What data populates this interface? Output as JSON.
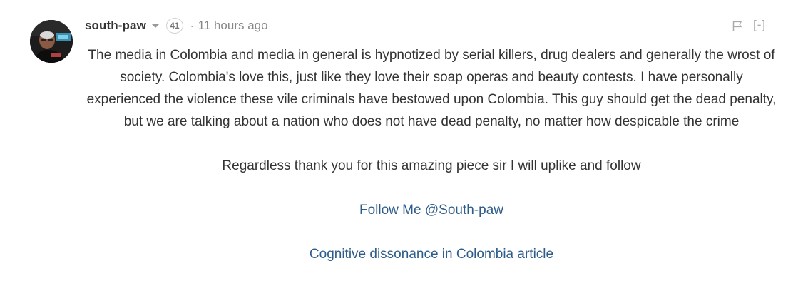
{
  "comment": {
    "author": "south-paw",
    "reputation": "41",
    "separator": "·",
    "timestamp": "11 hours ago",
    "collapse_label": "[-]",
    "icons": {
      "avatar": "user-avatar",
      "author_menu": "caret-down-icon",
      "flag": "flag-icon"
    },
    "body": {
      "paragraph_1": "The media in Colombia and media in general is hypnotized by serial killers, drug dealers and generally the wrost of society. Colombia's love this, just like they love their soap operas and beauty contests. I have personally experienced the violence these vile criminals have bestowed upon Colombia. This guy should get the dead penalty, but we are talking about a nation who does not have dead penalty, no matter how despicable the crime",
      "paragraph_2": "Regardless thank you for this amazing piece sir I will uplike and follow",
      "link_1": "Follow Me @South-paw",
      "link_2": "Cognitive dissonance in Colombia article"
    },
    "colors": {
      "text": "#333333",
      "link": "#2e5c8a",
      "muted": "#888888"
    }
  }
}
